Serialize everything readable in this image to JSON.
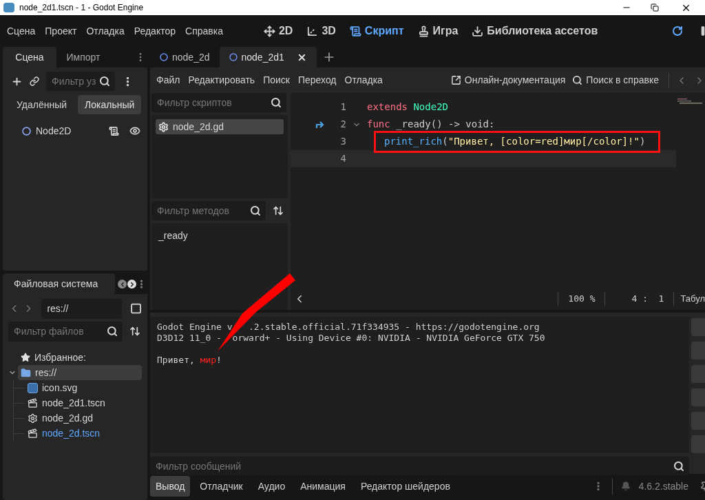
{
  "window": {
    "title": "node_2d1.tscn - 1 - Godot Engine"
  },
  "menu": [
    "Сцена",
    "Проект",
    "Отладка",
    "Редактор",
    "Справка"
  ],
  "workspaces": [
    {
      "label": "2D",
      "kind": "flat",
      "selected": false
    },
    {
      "label": "3D",
      "kind": "spatial",
      "selected": false
    },
    {
      "label": "Скрипт",
      "kind": "script",
      "selected": true
    },
    {
      "label": "Игра",
      "kind": "game",
      "selected": false
    },
    {
      "label": "Библиотека ассетов",
      "kind": "assets",
      "selected": false
    }
  ],
  "scene_dock": {
    "tabs": [
      {
        "label": "Сцена",
        "selected": true
      },
      {
        "label": "Импорт",
        "selected": false
      }
    ],
    "filter": {
      "placeholder": "Фильтр уз"
    },
    "modes": [
      {
        "label": "Удалённый",
        "selected": false
      },
      {
        "label": "Локальный",
        "selected": true
      }
    ],
    "nodes": [
      {
        "name": "Node2D"
      }
    ]
  },
  "filesystem": {
    "title": "Файловая система",
    "path": "res://",
    "filter": {
      "placeholder": "Фильтр файлов"
    },
    "favorites": "Избранное:",
    "tree": [
      {
        "label": "res://",
        "kind": "folder",
        "selected": true,
        "current": false,
        "children": [
          {
            "label": "icon.svg",
            "kind": "image",
            "selected": false,
            "current": false
          },
          {
            "label": "node_2d1.tscn",
            "kind": "scene",
            "selected": false,
            "current": false
          },
          {
            "label": "node_2d.gd",
            "kind": "script",
            "selected": false,
            "current": false
          },
          {
            "label": "node_2d.tscn",
            "kind": "scene",
            "selected": false,
            "current": true
          }
        ]
      }
    ]
  },
  "scene_tabs": [
    {
      "label": "node_2d",
      "selected": false
    },
    {
      "label": "node_2d1",
      "selected": true
    }
  ],
  "script_menu": [
    "Файл",
    "Редактировать",
    "Поиск",
    "Переход",
    "Отладка"
  ],
  "script_links": [
    {
      "label": "Онлайн-документация",
      "kind": "external"
    },
    {
      "label": "Поиск в справке",
      "kind": "help"
    }
  ],
  "scripts": {
    "filter": {
      "placeholder": "Фильтр скриптов"
    },
    "items": [
      {
        "label": "node_2d.gd",
        "selected": true
      }
    ]
  },
  "methods": {
    "filter": {
      "placeholder": "Фильтр методов"
    },
    "items": [
      "_ready"
    ]
  },
  "code": [
    {
      "number": "1",
      "override": false,
      "fold": false,
      "current": false,
      "indented": false,
      "framed": false,
      "tokens": [
        {
          "text": "extends",
          "kind": "keyword"
        },
        {
          "text": "Node2D",
          "kind": "class"
        }
      ]
    },
    {
      "number": "2",
      "override": true,
      "fold": true,
      "current": false,
      "indented": false,
      "framed": false,
      "tokens": [
        {
          "text": "func",
          "kind": "keyword"
        },
        {
          "text": "_ready() -> void:",
          "kind": "plain"
        }
      ]
    },
    {
      "number": "3",
      "override": false,
      "fold": false,
      "current": false,
      "indented": true,
      "framed": true,
      "tokens": [
        {
          "text": "print_rich",
          "kind": "call"
        },
        {
          "text": "(",
          "kind": "punct"
        },
        {
          "text": "\"Привет, [color=red]мир[/color]!\"",
          "kind": "string"
        },
        {
          "text": ")",
          "kind": "punct"
        }
      ]
    },
    {
      "number": "4",
      "override": false,
      "fold": false,
      "current": true,
      "indented": false,
      "framed": false
    }
  ],
  "status": {
    "zoom": "100 %",
    "line": "4",
    "separator": ":",
    "column": "1",
    "indent": "Табул"
  },
  "output": {
    "lines": [
      {
        "gap_before": false,
        "segments": [
          {
            "text": "Godot Engine v",
            "kind": "plain"
          },
          {
            "text": ".2.stable.official.71f334935 - https://godotengine.org",
            "kind": "plain"
          }
        ]
      },
      {
        "gap_before": false,
        "segments": [
          {
            "text": "D3D12 11_0 - ",
            "kind": "plain"
          },
          {
            "text": "orward+ - Using Device #0: NVIDIA - NVIDIA GeForce GTX 750",
            "kind": "plain"
          }
        ]
      },
      {
        "gap_before": true,
        "segments": [
          {
            "text": "Привет, ",
            "kind": "plain"
          },
          {
            "text": "мир",
            "kind": "red"
          },
          {
            "text": "!",
            "kind": "plain"
          }
        ]
      }
    ],
    "filter": {
      "placeholder": "Фильтр сообщений"
    }
  },
  "bottom_tabs": [
    {
      "label": "Вывод",
      "selected": true
    },
    {
      "label": "Отладчик",
      "selected": false
    },
    {
      "label": "Аудио",
      "selected": false
    },
    {
      "label": "Анимация",
      "selected": false
    },
    {
      "label": "Редактор шейдеров",
      "selected": false
    }
  ],
  "version": "4.6.2.stable"
}
